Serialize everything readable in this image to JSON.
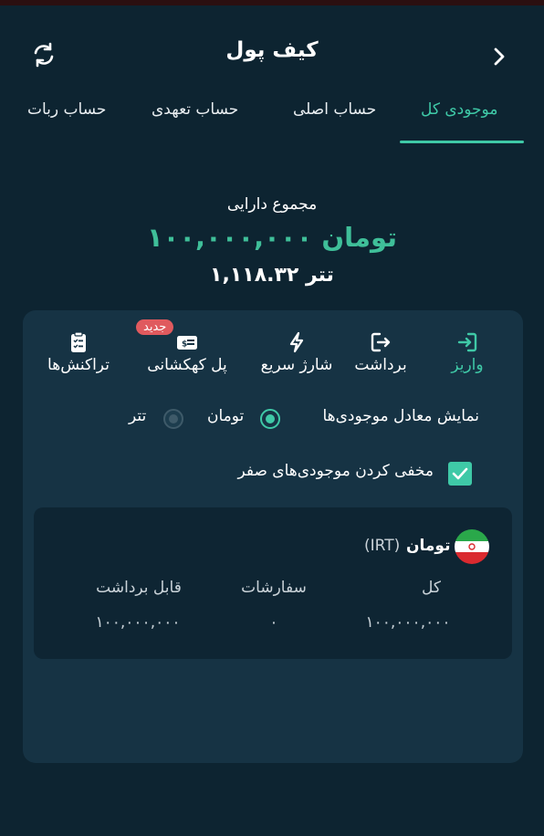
{
  "header": {
    "title": "کیف پول"
  },
  "icons": {
    "back": "chevron-right-icon",
    "refresh": "refresh-icon"
  },
  "tabs": [
    {
      "label": "موجودی کل",
      "active": true
    },
    {
      "label": "حساب اصلی",
      "active": false
    },
    {
      "label": "حساب تعهدی",
      "active": false
    },
    {
      "label": "حساب ربات",
      "active": false
    }
  ],
  "summary": {
    "label": "مجموع دارایی",
    "value": "۱۰۰,۰۰۰,۰۰۰ تومان",
    "usdt": "۱,۱۱۸.۳۲ تتر"
  },
  "actions": [
    {
      "label": "واریز",
      "icon": "login-arrow-icon",
      "active": true
    },
    {
      "label": "برداشت",
      "icon": "logout-arrow-icon",
      "active": false
    },
    {
      "label": "شارژ سریع",
      "icon": "lightning-icon",
      "active": false
    },
    {
      "label": "پل کهکشانی",
      "icon": "money-card-icon",
      "active": false,
      "badge": "جدید"
    },
    {
      "label": "تراکنش‌ها",
      "icon": "clipboard-check-icon",
      "active": false
    }
  ],
  "equivalent": {
    "label": "نمایش معادل موجودی‌ها",
    "options": [
      {
        "label": "تومان",
        "checked": true
      },
      {
        "label": "تتر",
        "checked": false
      }
    ]
  },
  "hide_zero": {
    "label": "مخفی کردن موجودی‌های صفر",
    "checked": true
  },
  "balance_card": {
    "currency_name": "تومان",
    "currency_code": "(IRT)",
    "flag": "iran-flag-icon",
    "columns": [
      {
        "header": "کل",
        "value": "۱۰۰,۰۰۰,۰۰۰"
      },
      {
        "header": "سفارشات",
        "value": "۰"
      },
      {
        "header": "قابل برداشت",
        "value": "۱۰۰,۰۰۰,۰۰۰"
      }
    ]
  },
  "colors": {
    "background": "#0d2431",
    "panel": "#163344",
    "card": "#0e2533",
    "accent": "#3fc9a7",
    "badge": "#e05a5e"
  }
}
